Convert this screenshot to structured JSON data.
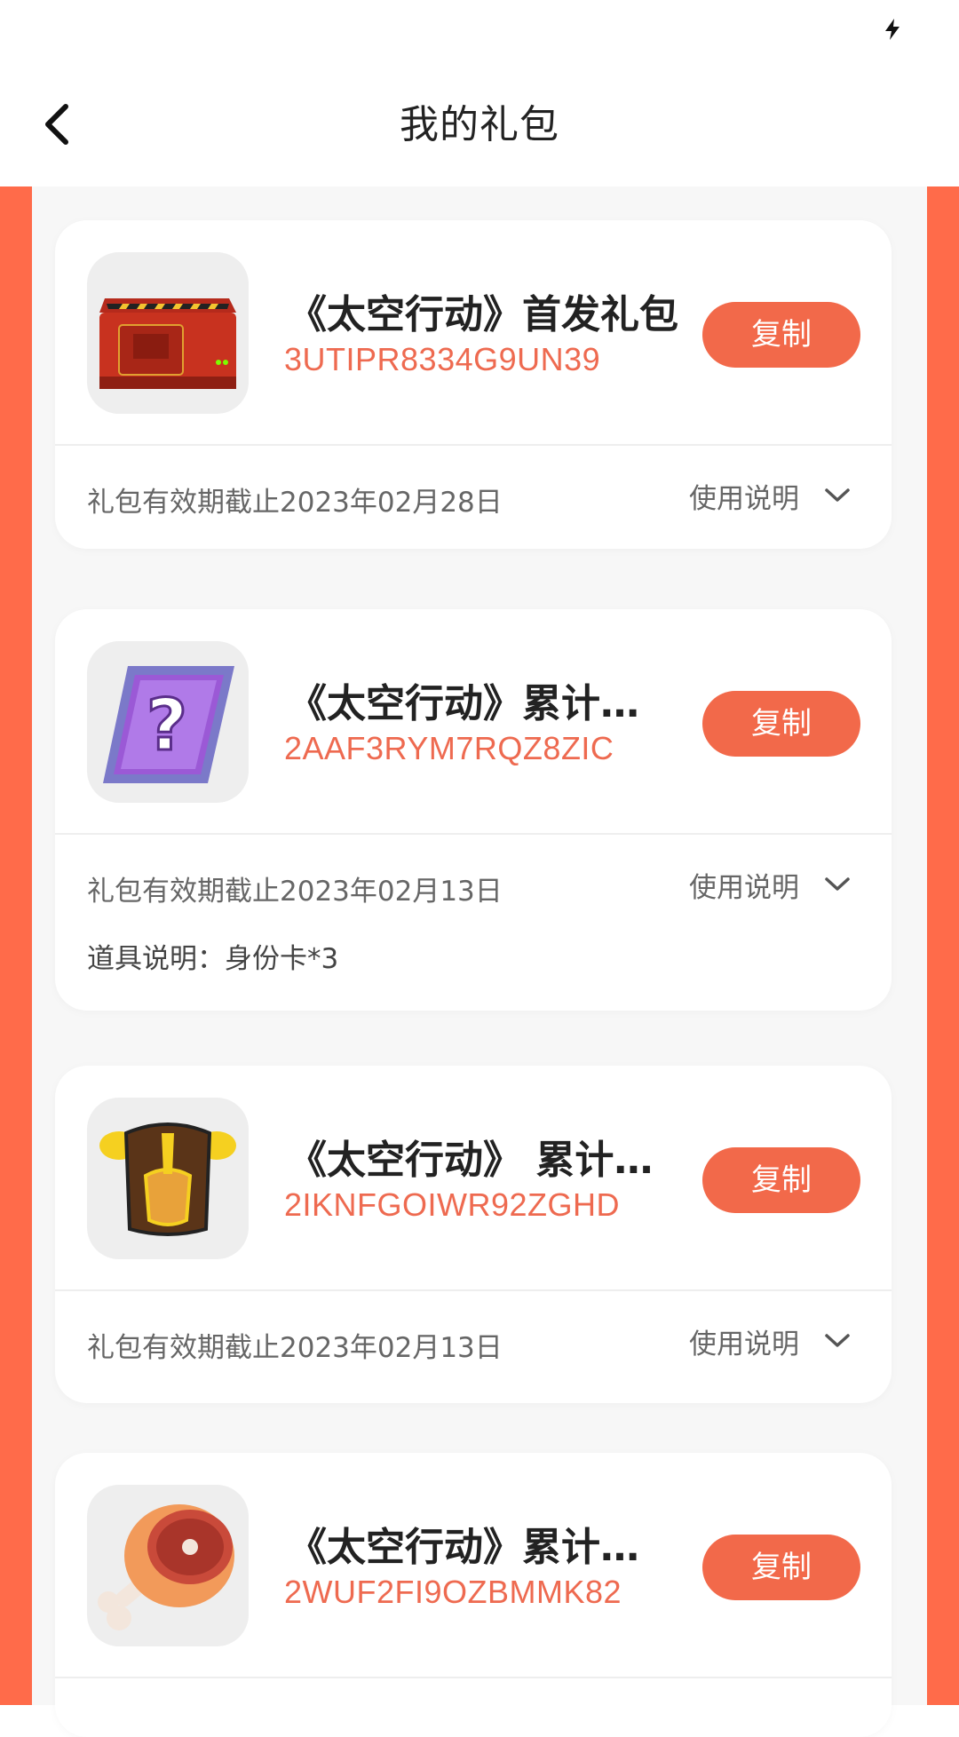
{
  "status_bar": {
    "icon": "charging-bolt-icon"
  },
  "header": {
    "title": "我的礼包",
    "back_icon": "chevron-left-icon"
  },
  "gifts": [
    {
      "title": "《太空行动》首发礼包",
      "code": "3UTIPR8334G9UN39",
      "copy_label": "复制",
      "expiry": "礼包有效期截止2023年02月28日",
      "usage_label": "使用说明",
      "icon": "red-crate-icon"
    },
    {
      "title": "《太空行动》累计…",
      "code": "2AAF3RYM7RQZ8ZIC",
      "copy_label": "复制",
      "expiry": "礼包有效期截止2023年02月13日",
      "usage_label": "使用说明",
      "item_desc": "道具说明：身份卡*3",
      "icon": "mystery-card-icon"
    },
    {
      "title": "《太空行动》 累计…",
      "code": "2IKNFGOIWR92ZGHD",
      "copy_label": "复制",
      "expiry": "礼包有效期截止2023年02月13日",
      "usage_label": "使用说明",
      "icon": "armor-icon"
    },
    {
      "title": "《太空行动》累计…",
      "code": "2WUF2FI9OZBMMK82",
      "copy_label": "复制",
      "icon": "meat-icon"
    }
  ],
  "colors": {
    "accent": "#F2694A",
    "code_text": "#EE6A50",
    "background_orange": "#FF6B4A"
  }
}
